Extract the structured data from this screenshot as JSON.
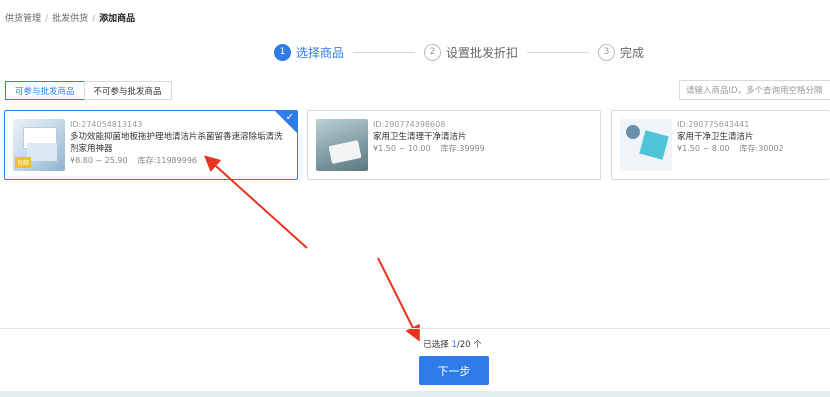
{
  "breadcrumb": {
    "items": [
      "供货管理",
      "批发供货"
    ],
    "separator": "/",
    "current": "添加商品"
  },
  "steps": [
    {
      "num": "1",
      "label": "选择商品",
      "active": true
    },
    {
      "num": "2",
      "label": "设置批发折扣",
      "active": false
    },
    {
      "num": "3",
      "label": "完成",
      "active": false
    }
  ],
  "filter_tabs": [
    "可参与批发商品",
    "不可参与批发商品"
  ],
  "search": {
    "placeholder": "请输入商品ID，多个查询用空格分隔"
  },
  "products": [
    {
      "id": "ID:274054813143",
      "name": "多功效能抑菌地板拖护理地清洁片杀菌留香速溶除垢清洗剂家用神器",
      "price": "¥8.80 ~ 25.90",
      "stock": "库存:11989996",
      "selected": true,
      "badge": "包邮"
    },
    {
      "id": "ID:290774398608",
      "name": "家用卫生清理干净清洁片",
      "price": "¥1.50 ~ 10.00",
      "stock": "库存:39999",
      "selected": false
    },
    {
      "id": "ID:290775643441",
      "name": "家用干净卫生清洁片",
      "price": "¥1.50 ~ 8.00",
      "stock": "库存:30002",
      "selected": false
    }
  ],
  "footer": {
    "selected_prefix": "已选择 ",
    "selected_count": "1",
    "selected_suffix": "/20 个",
    "next_label": "下一步"
  },
  "colors": {
    "accent": "#2f7ce8",
    "arrow": "#e8321e"
  }
}
